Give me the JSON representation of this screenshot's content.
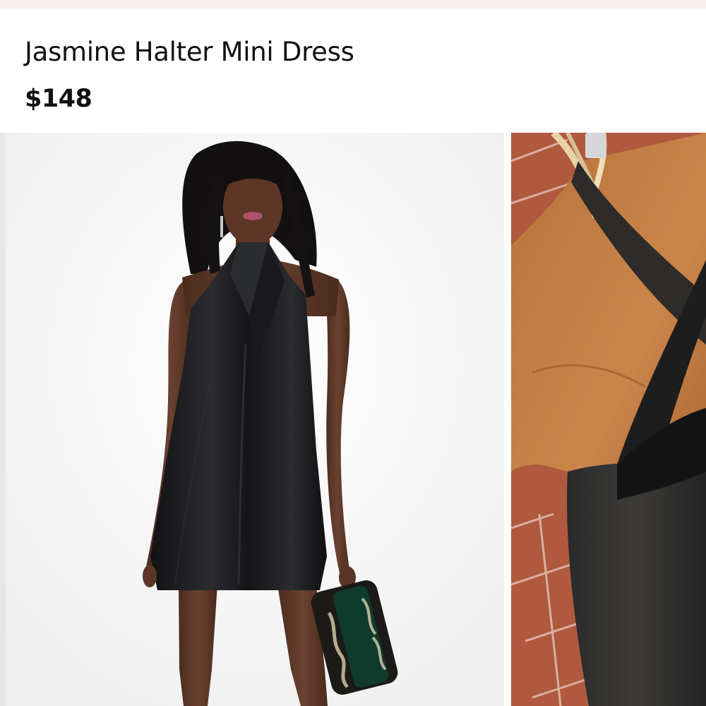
{
  "product": {
    "title": "Jasmine Halter Mini Dress",
    "price": "$148"
  },
  "gallery": {
    "images": [
      {
        "name": "model-front-photo"
      },
      {
        "name": "neckline-detail-photo"
      }
    ]
  },
  "colors": {
    "top_strip": "#fbeeee",
    "text": "#111111",
    "dress": "#1c1c1e",
    "tile": "#b05a3f"
  }
}
